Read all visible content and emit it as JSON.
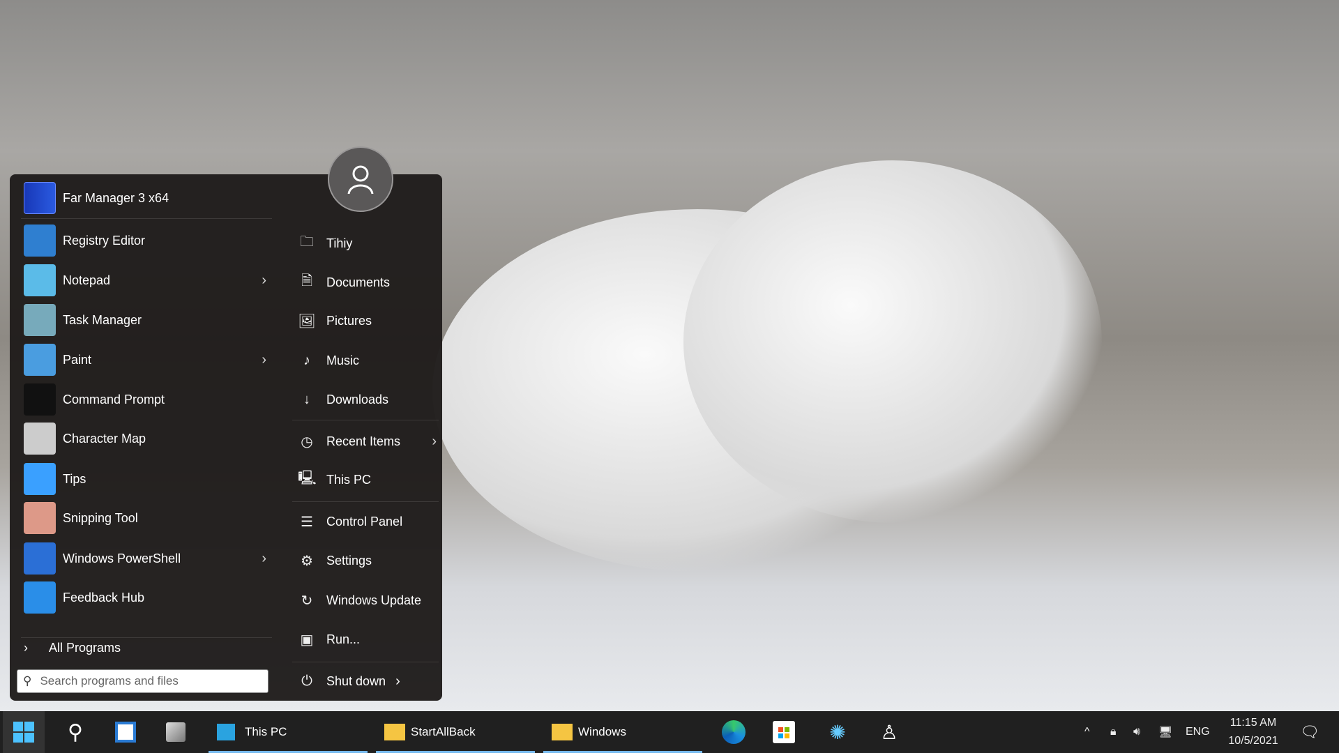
{
  "start_menu": {
    "pinned": {
      "label": "Far Manager 3 x64",
      "icon": "far-manager-icon"
    },
    "programs": [
      {
        "label": "Registry Editor",
        "icon": "registry-editor-icon",
        "submenu": false
      },
      {
        "label": "Notepad",
        "icon": "notepad-icon",
        "submenu": true
      },
      {
        "label": "Task Manager",
        "icon": "task-manager-icon",
        "submenu": false
      },
      {
        "label": "Paint",
        "icon": "paint-icon",
        "submenu": true
      },
      {
        "label": "Command Prompt",
        "icon": "command-prompt-icon",
        "submenu": false
      },
      {
        "label": "Character Map",
        "icon": "character-map-icon",
        "submenu": false
      },
      {
        "label": "Tips",
        "icon": "tips-icon",
        "submenu": false
      },
      {
        "label": "Snipping Tool",
        "icon": "snipping-tool-icon",
        "submenu": false
      },
      {
        "label": "Windows PowerShell",
        "icon": "powershell-icon",
        "submenu": true
      },
      {
        "label": "Feedback Hub",
        "icon": "feedback-hub-icon",
        "submenu": false
      }
    ],
    "all_programs": "All Programs",
    "search_placeholder": "Search programs and files",
    "places": [
      {
        "label": "Tihiy",
        "icon": "user-folder-icon"
      },
      {
        "label": "Documents",
        "icon": "document-icon"
      },
      {
        "label": "Pictures",
        "icon": "picture-icon"
      },
      {
        "label": "Music",
        "icon": "music-icon"
      },
      {
        "label": "Downloads",
        "icon": "download-icon"
      },
      {
        "label": "Recent Items",
        "icon": "clock-icon"
      },
      {
        "label": "This PC",
        "icon": "computer-icon"
      },
      {
        "label": "Control Panel",
        "icon": "control-panel-icon"
      },
      {
        "label": "Settings",
        "icon": "gear-icon"
      },
      {
        "label": "Windows Update",
        "icon": "refresh-icon"
      },
      {
        "label": "Run...",
        "icon": "run-icon"
      }
    ],
    "shutdown": "Shut down"
  },
  "taskbar": {
    "windows": [
      {
        "label": "This PC"
      },
      {
        "label": "StartAllBack"
      },
      {
        "label": "Windows"
      }
    ],
    "tray": {
      "language": "ENG",
      "time": "11:15 AM",
      "date": "10/5/2021"
    },
    "accent": "#76b9ed"
  }
}
